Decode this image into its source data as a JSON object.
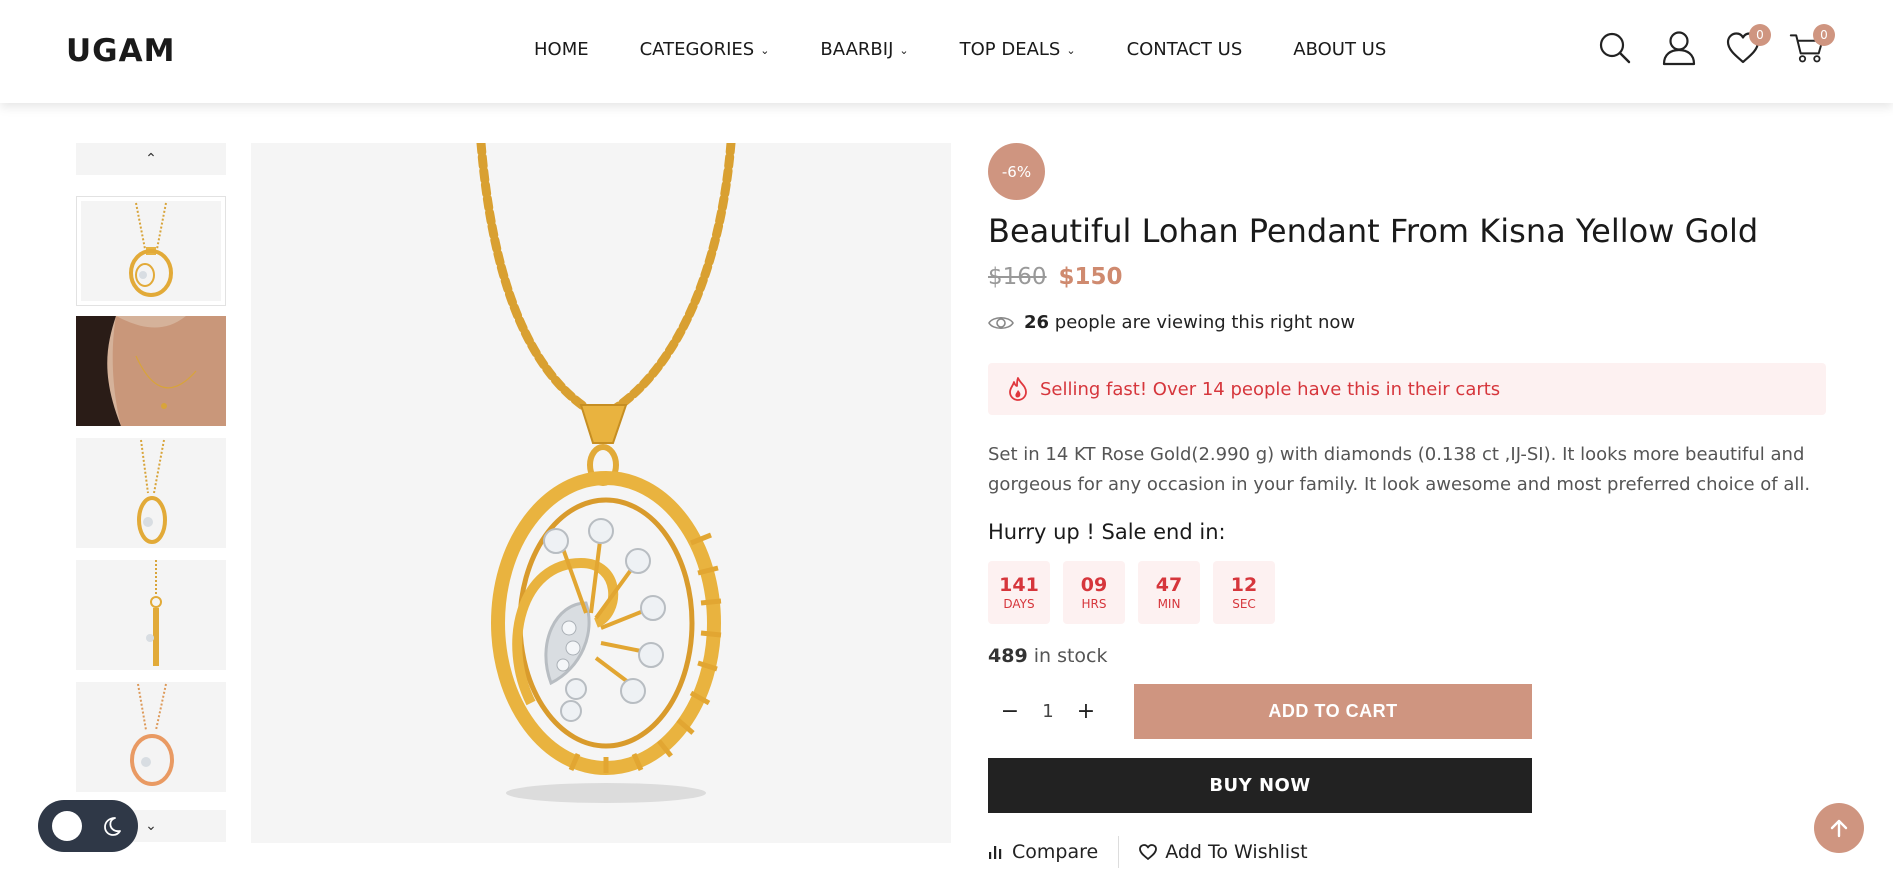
{
  "header": {
    "logo": "UGAM",
    "nav": [
      {
        "label": "HOME",
        "has_dropdown": false
      },
      {
        "label": "CATEGORIES",
        "has_dropdown": true
      },
      {
        "label": "BAARBIJ",
        "has_dropdown": true
      },
      {
        "label": "TOP DEALS",
        "has_dropdown": true
      },
      {
        "label": "CONTACT US",
        "has_dropdown": false
      },
      {
        "label": "ABOUT US",
        "has_dropdown": false
      }
    ],
    "icons": [
      "search-icon",
      "user-icon",
      "heart-icon",
      "cart-icon"
    ],
    "wishlist_count": "0",
    "cart_count": "0"
  },
  "gallery": {
    "thumbnails": [
      "pendant-front",
      "model-wearing",
      "pendant-angle",
      "pendant-side",
      "pendant-rose-gold"
    ],
    "active_index": 0
  },
  "product": {
    "discount_badge": "-6%",
    "title": "Beautiful Lohan Pendant From Kisna Yellow Gold",
    "old_price": "$160",
    "price": "$150",
    "viewers_count": "26",
    "viewers_text": "people are viewing this right now",
    "selling_fast": "Selling fast! Over 14 people have this in their carts",
    "description": "Set in 14 KT Rose Gold(2.990 g) with diamonds (0.138 ct ,IJ-SI). It looks more beautiful and gorgeous for any occasion in your family. It look awesome and most preferred choice of all.",
    "hurry_text": "Hurry up ! Sale end in:",
    "countdown": [
      {
        "value": "141",
        "label": "DAYS"
      },
      {
        "value": "09",
        "label": "HRS"
      },
      {
        "value": "47",
        "label": "MIN"
      },
      {
        "value": "12",
        "label": "SEC"
      }
    ],
    "stock_count": "489",
    "stock_text": "in stock",
    "quantity": "1",
    "qty_minus": "−",
    "qty_plus": "+",
    "add_to_cart": "ADD TO CART",
    "buy_now": "BUY NOW",
    "compare": "Compare",
    "wishlist": "Add To Wishlist"
  },
  "colors": {
    "accent": "#cf9580",
    "alert_red": "#d6363c",
    "alert_bg": "#fdf1f1",
    "dark": "#222222"
  }
}
